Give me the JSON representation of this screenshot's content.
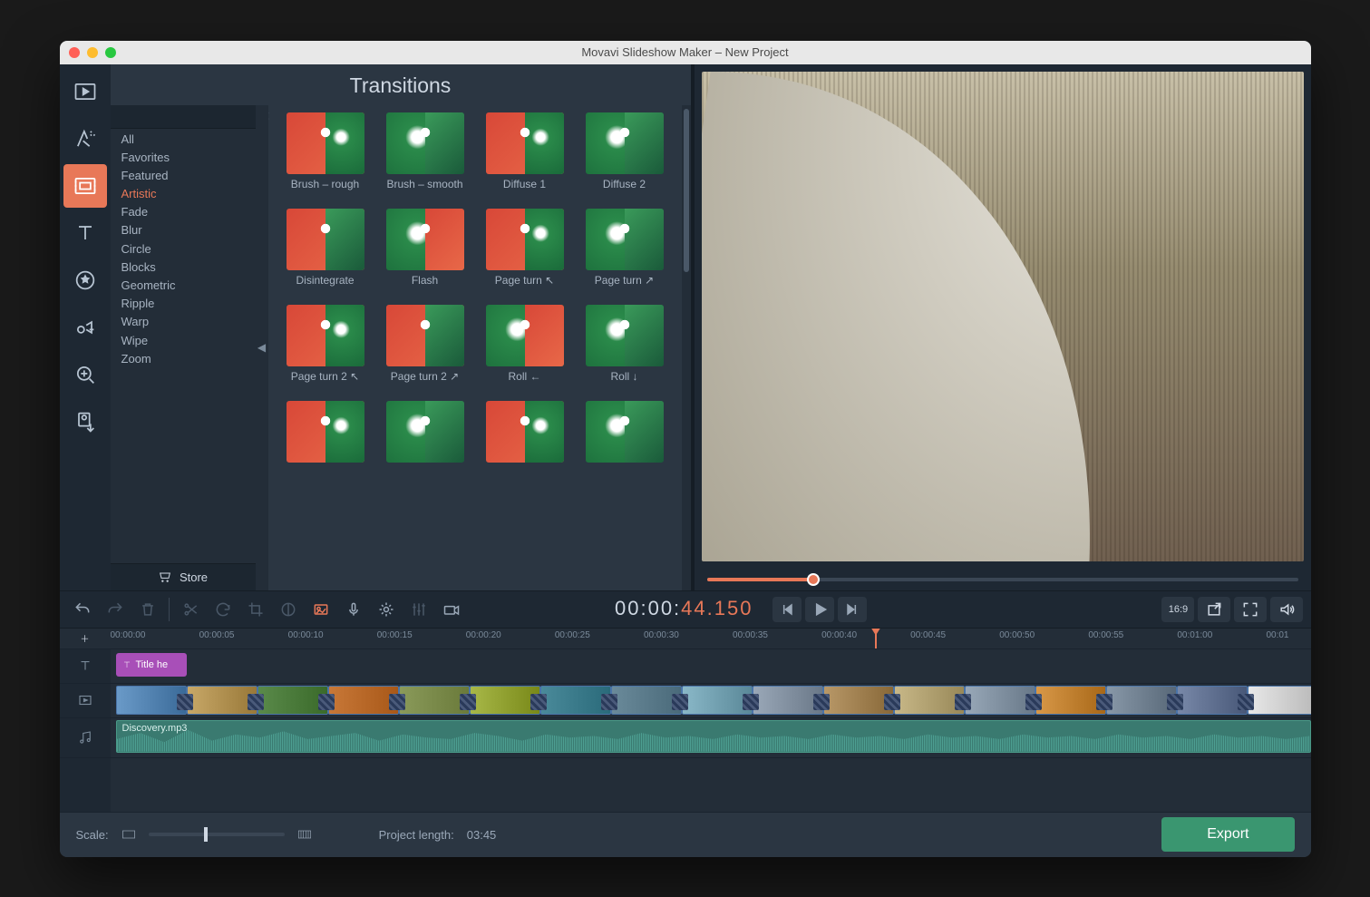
{
  "window": {
    "title": "Movavi Slideshow Maker – New Project"
  },
  "panel": {
    "title": "Transitions",
    "search_placeholder": "",
    "categories": [
      "All",
      "Favorites",
      "Featured",
      "Artistic",
      "Fade",
      "Blur",
      "Circle",
      "Blocks",
      "Geometric",
      "Ripple",
      "Warp",
      "Wipe",
      "Zoom"
    ],
    "selected_category": "Artistic",
    "store_label": "Store",
    "transitions": [
      {
        "label": "Brush – rough"
      },
      {
        "label": "Brush – smooth"
      },
      {
        "label": "Diffuse 1"
      },
      {
        "label": "Diffuse 2"
      },
      {
        "label": "Disintegrate"
      },
      {
        "label": "Flash"
      },
      {
        "label": "Page turn ↖"
      },
      {
        "label": "Page turn ↗"
      },
      {
        "label": "Page turn 2 ↖"
      },
      {
        "label": "Page turn 2 ↗"
      },
      {
        "label": "Roll ←"
      },
      {
        "label": "Roll ↓"
      },
      {
        "label": ""
      },
      {
        "label": ""
      },
      {
        "label": ""
      },
      {
        "label": ""
      }
    ]
  },
  "playback": {
    "time_gray": "00:00:",
    "time_orange": "44.150",
    "seek_percent": 18,
    "aspect": "16:9"
  },
  "timeline": {
    "ticks": [
      "00:00:00",
      "00:00:05",
      "00:00:10",
      "00:00:15",
      "00:00:20",
      "00:00:25",
      "00:00:30",
      "00:00:35",
      "00:00:40",
      "00:00:45",
      "00:00:50",
      "00:00:55",
      "00:01:00",
      "00:01"
    ],
    "playhead_index": 8.6,
    "title_clip_label": "Title he",
    "audio_clip_label": "Discovery.mp3",
    "video_clip_count": 17
  },
  "footer": {
    "scale_label": "Scale:",
    "project_length_label": "Project length:",
    "project_length_value": "03:45",
    "export_label": "Export"
  },
  "sidebar_icons": [
    "media",
    "filters",
    "transitions",
    "titles",
    "stickers",
    "callouts",
    "zoom-pan",
    "record"
  ],
  "clip_palettes": [
    "linear-gradient(90deg,#6a9ac8,#3a6a98)",
    "linear-gradient(90deg,#c8a868,#987838)",
    "linear-gradient(90deg,#5a8a4a,#3a6a2a)",
    "linear-gradient(90deg,#c87838,#a85818)",
    "linear-gradient(90deg,#8a9a5a,#6a7a3a)",
    "linear-gradient(90deg,#a8b848,#788818)",
    "linear-gradient(90deg,#4a8a9a,#2a6a7a)",
    "linear-gradient(90deg,#6a8a9a,#4a6a7a)",
    "linear-gradient(90deg,#8ab8c8,#5a8898)",
    "linear-gradient(90deg,#9aa8b8,#6a7888)",
    "linear-gradient(90deg,#b89868,#886838)",
    "linear-gradient(90deg,#c8b888,#988858)",
    "linear-gradient(90deg,#98a8b8,#687888)",
    "linear-gradient(90deg,#d89848,#a86818)",
    "linear-gradient(90deg,#8898a8,#586878)",
    "linear-gradient(90deg,#7888a8,#485878)",
    "linear-gradient(90deg,#e8e8e8,#b8b8b8)"
  ]
}
